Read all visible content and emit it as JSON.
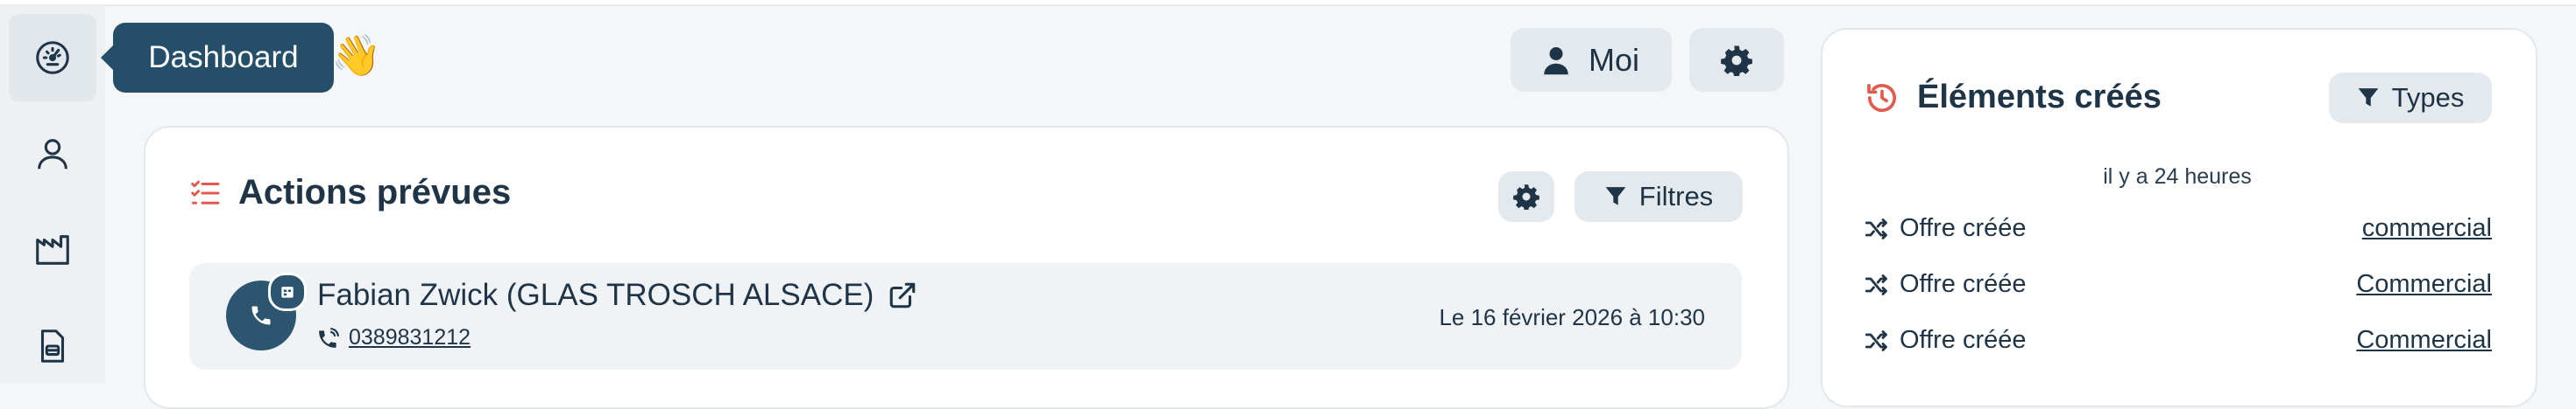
{
  "tooltip": {
    "label": "Dashboard",
    "emoji": "👋"
  },
  "header": {
    "user_label": "Moi"
  },
  "sidebar": {
    "items": [
      {
        "icon": "dashboard-gauge-icon",
        "active": true
      },
      {
        "icon": "user-icon"
      },
      {
        "icon": "factory-icon"
      },
      {
        "icon": "document-icon"
      }
    ]
  },
  "actions": {
    "title": "Actions prévues",
    "filters_label": "Filtres",
    "items": [
      {
        "name": "Fabian Zwick (GLAS TROSCH ALSACE)",
        "phone": "0389831212",
        "date": "Le 16 février 2026 à 10:30"
      }
    ]
  },
  "created": {
    "title": "Éléments créés",
    "types_label": "Types",
    "time_label": "il y a 24 heures",
    "items": [
      {
        "label": "Offre créée",
        "link": "commercial"
      },
      {
        "label": "Offre créée",
        "link": "Commercial"
      },
      {
        "label": "Offre créée",
        "link": "Commercial"
      }
    ]
  },
  "colors": {
    "accent_red": "#e05a4e",
    "navy": "#254e68",
    "text": "#1f3447"
  }
}
